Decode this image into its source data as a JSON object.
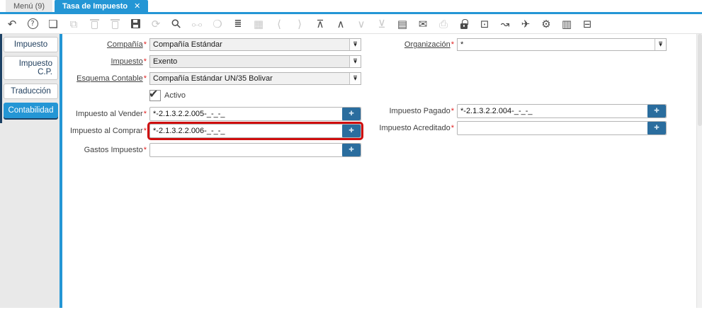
{
  "window_tabs": {
    "menu": {
      "label": "Menú (9)"
    },
    "active": {
      "label": "Tasa de Impuesto",
      "close_glyph": "✕"
    }
  },
  "toolbar": {
    "buttons": [
      {
        "name": "undo-icon",
        "glyph": "↶",
        "enabled": true
      },
      {
        "name": "help-icon",
        "glyph": "?",
        "enabled": true
      },
      {
        "name": "new-record-icon",
        "glyph": "❏",
        "enabled": true
      },
      {
        "name": "copy-record-icon",
        "glyph": "⧉",
        "enabled": false
      },
      {
        "name": "delete-record-icon",
        "glyph": "",
        "enabled": false
      },
      {
        "name": "delete-selection-icon",
        "glyph": "",
        "enabled": false
      },
      {
        "name": "save-icon",
        "glyph": "",
        "enabled": true
      },
      {
        "name": "refresh-icon",
        "glyph": "⟳",
        "enabled": false
      },
      {
        "name": "find-icon",
        "glyph": "⚲",
        "enabled": true
      },
      {
        "name": "attachment-icon",
        "glyph": "⧟",
        "enabled": false
      },
      {
        "name": "chat-icon",
        "glyph": "❍",
        "enabled": false
      },
      {
        "name": "grid-toggle-icon",
        "glyph": "≣",
        "enabled": true
      },
      {
        "name": "history-calendar-icon",
        "glyph": "▦",
        "enabled": false
      },
      {
        "name": "previous-record-icon",
        "glyph": "⟨",
        "enabled": false
      },
      {
        "name": "next-record-icon",
        "glyph": "⟩",
        "enabled": false
      },
      {
        "name": "parent-record-icon",
        "glyph": "⊼",
        "enabled": true
      },
      {
        "name": "up-icon",
        "glyph": "∧",
        "enabled": true
      },
      {
        "name": "down-icon",
        "glyph": "∨",
        "enabled": false
      },
      {
        "name": "detail-record-icon",
        "glyph": "⊻",
        "enabled": false
      },
      {
        "name": "report-icon",
        "glyph": "▤",
        "enabled": true
      },
      {
        "name": "archive-icon",
        "glyph": "✉",
        "enabled": true
      },
      {
        "name": "print-icon",
        "glyph": "⎙",
        "enabled": false
      },
      {
        "name": "lock-icon",
        "glyph": "",
        "enabled": true
      },
      {
        "name": "zoom-across-icon",
        "glyph": "⊡",
        "enabled": true
      },
      {
        "name": "workflow-icon",
        "glyph": "↝",
        "enabled": true
      },
      {
        "name": "send-mail-icon",
        "glyph": "✈",
        "enabled": true
      },
      {
        "name": "preference-icon",
        "glyph": "⚙",
        "enabled": true
      },
      {
        "name": "report-find-icon",
        "glyph": "▥",
        "enabled": true
      },
      {
        "name": "presentation-icon",
        "glyph": "⊟",
        "enabled": true
      }
    ]
  },
  "sidebar": {
    "tabs": [
      {
        "id": "impuesto",
        "label": "Impuesto",
        "active": false,
        "multiline": false
      },
      {
        "id": "impuesto-cp",
        "label": "Impuesto C.P.",
        "active": false,
        "multiline": true
      },
      {
        "id": "traduccion",
        "label": "Traducción",
        "active": false,
        "multiline": false
      },
      {
        "id": "contabilidad",
        "label": "Contabilidad",
        "active": true,
        "multiline": false
      }
    ]
  },
  "form": {
    "fields": {
      "compania": {
        "label": "Compañía",
        "required": "*",
        "value": "Compañía Estándar"
      },
      "organizacion": {
        "label": "Organización",
        "required": "*",
        "value": "*"
      },
      "impuesto": {
        "label": "Impuesto",
        "required": "*",
        "value": "Exento"
      },
      "esquema_contable": {
        "label": "Esquema Contable",
        "required": "*",
        "value": "Compañía Estándar UN/35 Bolivar"
      },
      "activo": {
        "label": "Activo",
        "checked": true,
        "checkmark": "✔"
      },
      "impuesto_al_vender": {
        "label": "Impuesto al Vender",
        "required": "*",
        "value": "*-2.1.3.2.2.005-_-_-_"
      },
      "impuesto_al_comprar": {
        "label": "Impuesto al Comprar",
        "required": "*",
        "value": "*-2.1.3.2.2.006-_-_-_"
      },
      "gastos_impuesto": {
        "label": "Gastos Impuesto",
        "required": "*",
        "value": ""
      },
      "impuesto_pagado": {
        "label": "Impuesto Pagado",
        "required": "*",
        "value": "*-2.1.3.2.2.004-_-_-_"
      },
      "impuesto_acreditado": {
        "label": "Impuesto Acreditado",
        "required": "*",
        "value": ""
      }
    }
  },
  "ui": {
    "combo_arrow": "▼",
    "account_button_glyph": "✚"
  },
  "colors": {
    "accent_blue": "#2496d5",
    "account_button_blue": "#2a6d9e",
    "highlight_red": "#cf0e0e",
    "sidebar_navy": "#1c4164"
  }
}
